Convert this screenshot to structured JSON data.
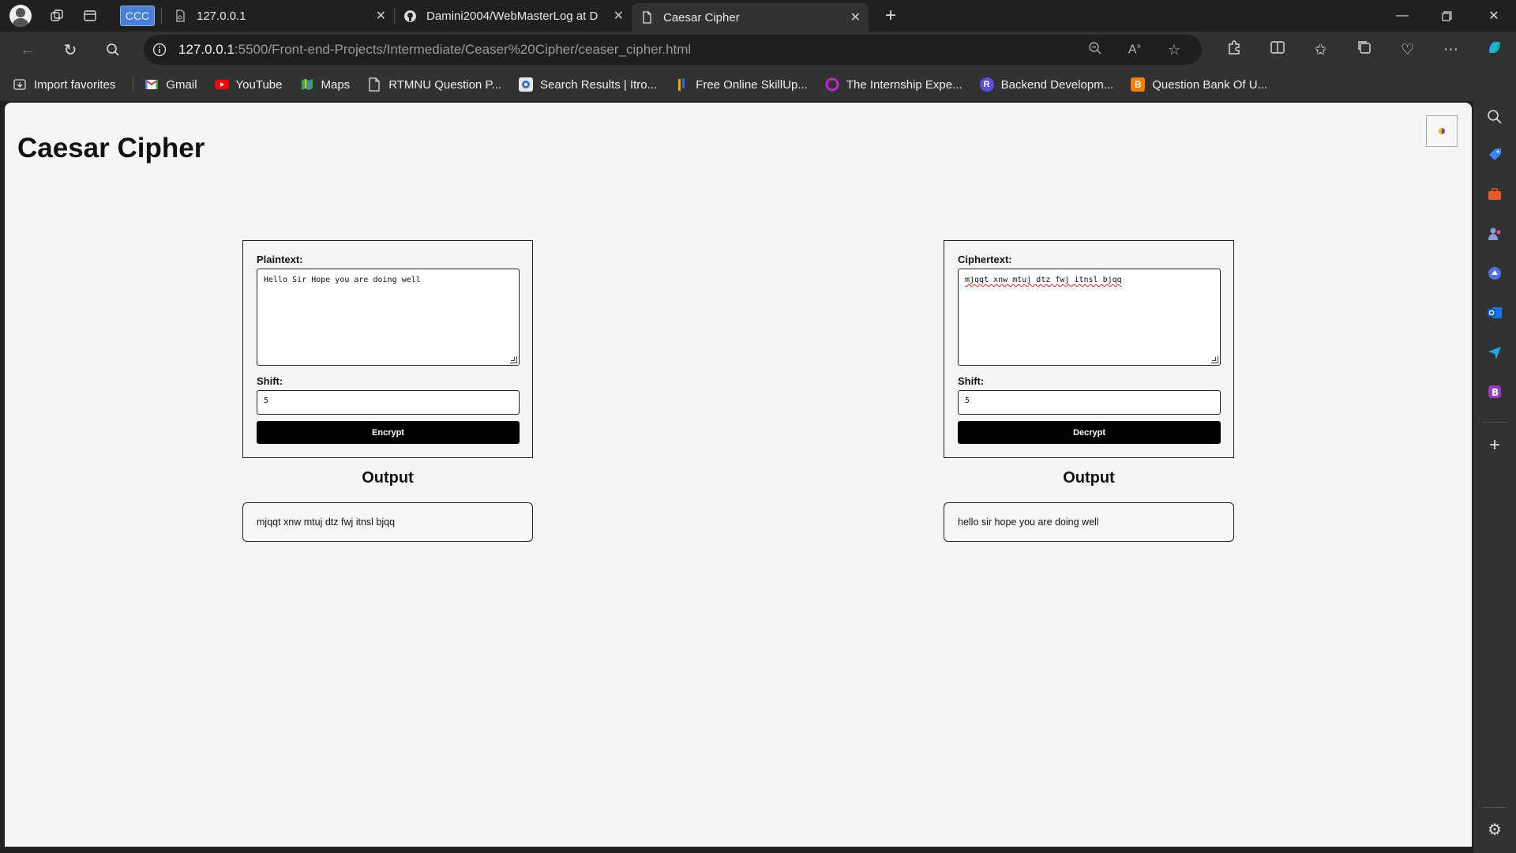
{
  "browser": {
    "tabs": [
      {
        "label": "CCC",
        "pinned": true
      },
      {
        "label": "127.0.0.1",
        "icon": "page-icon"
      },
      {
        "label": "Damini2004/WebMasterLog at D",
        "icon": "github-icon"
      },
      {
        "label": "Caesar Cipher",
        "icon": "page-icon",
        "active": true
      }
    ],
    "url_host": "127.0.0.1",
    "url_path": ":5500/Front-end-Projects/Intermediate/Ceaser%20Cipher/ceaser_cipher.html",
    "bookmarks": [
      {
        "label": "Import favorites",
        "icon": "import-icon"
      },
      {
        "label": "Gmail",
        "icon": "gmail-icon",
        "color": "#d93025"
      },
      {
        "label": "YouTube",
        "icon": "youtube-icon",
        "color": "#ff0000"
      },
      {
        "label": "Maps",
        "icon": "maps-icon",
        "color": "#34a853"
      },
      {
        "label": "RTMNU Question P...",
        "icon": "page-icon"
      },
      {
        "label": "Search Results | Itro...",
        "icon": "search-results-icon",
        "color": "#e8e8e8"
      },
      {
        "label": "Free Online SkillUp...",
        "icon": "skillup-icon",
        "color": "#f4a300"
      },
      {
        "label": "The Internship Expe...",
        "icon": "internship-icon",
        "color": "#c026d3"
      },
      {
        "label": "Backend Developm...",
        "icon": "backend-icon",
        "color": "#5b4fe0"
      },
      {
        "label": "Question Bank Of U...",
        "icon": "blogger-icon",
        "color": "#f57d00"
      }
    ]
  },
  "page": {
    "title": "Caesar Cipher",
    "encrypt": {
      "text_label": "Plaintext:",
      "text_value": "Hello Sir Hope you are doing well",
      "shift_label": "Shift:",
      "shift_value": "5",
      "button_label": "Encrypt",
      "output_title": "Output",
      "output_value": "mjqqt xnw mtuj dtz fwj itnsl bjqq"
    },
    "decrypt": {
      "text_label": "Ciphertext:",
      "text_value": "mjqqt xnw mtuj dtz fwj itnsl bjqq",
      "shift_label": "Shift:",
      "shift_value": "5",
      "button_label": "Decrypt",
      "output_title": "Output",
      "output_value": "hello sir hope you are doing well"
    }
  }
}
